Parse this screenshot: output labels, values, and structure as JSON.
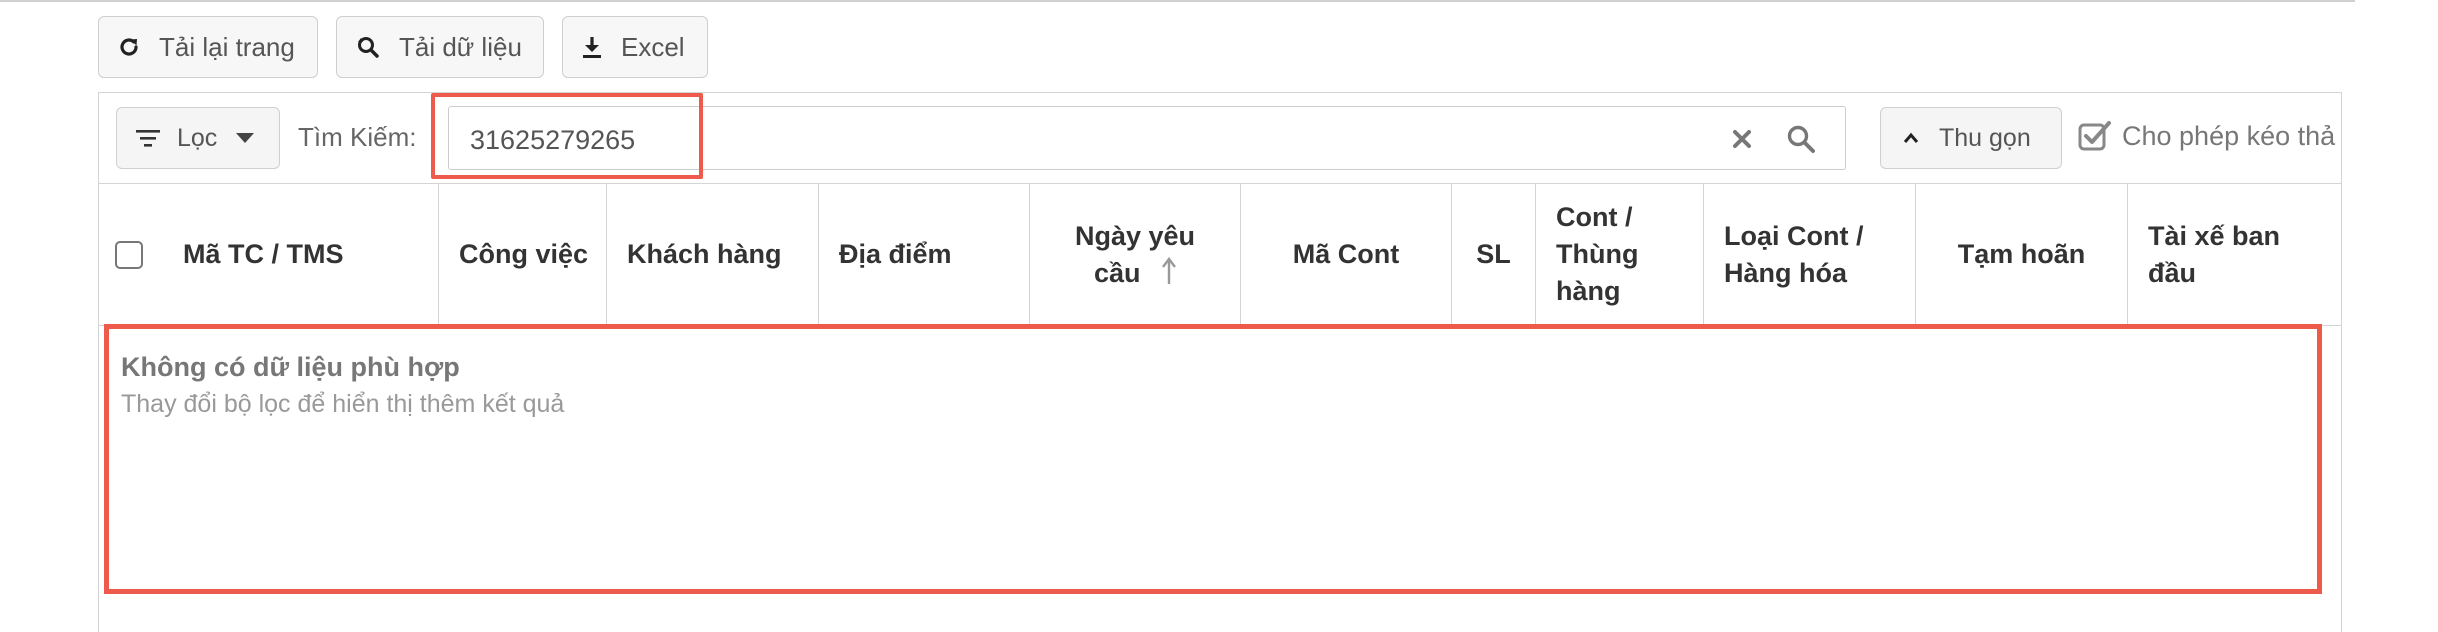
{
  "toolbar": {
    "reload_label": "Tải lại trang",
    "load_data_label": "Tải dữ liệu",
    "excel_label": "Excel"
  },
  "filter_bar": {
    "filter_label": "Lọc",
    "search_label": "Tìm Kiếm:",
    "search_value": "31625279265",
    "collapse_label": "Thu gọn",
    "drag_label": "Cho phép kéo thả",
    "drag_checked": true
  },
  "table": {
    "headers": {
      "ma_tc": "Mã TC / TMS",
      "cong_viec": "Công việc",
      "khach_hang": "Khách hàng",
      "dia_diem": "Địa điểm",
      "ngay_yeu_cau_1": "Ngày yêu",
      "ngay_yeu_cau_2": "cầu",
      "ma_cont": "Mã Cont",
      "sl": "SL",
      "cont_thung_1": "Cont /",
      "cont_thung_2": "Thùng",
      "cont_thung_3": "hàng",
      "loai_cont_1": "Loại Cont /",
      "loai_cont_2": "Hàng hóa",
      "tam_hoan": "Tạm hoãn",
      "tai_xe_1": "Tài xế ban",
      "tai_xe_2": "đầu"
    },
    "sort_column": "Ngày yêu cầu",
    "sort_direction": "ascending"
  },
  "empty_state": {
    "title": "Không có dữ liệu phù hợp",
    "subtitle": "Thay đổi bộ lọc để hiển thị thêm kết quả"
  },
  "colors": {
    "highlight": "#ee5a4c",
    "border": "#d4d4d4"
  }
}
